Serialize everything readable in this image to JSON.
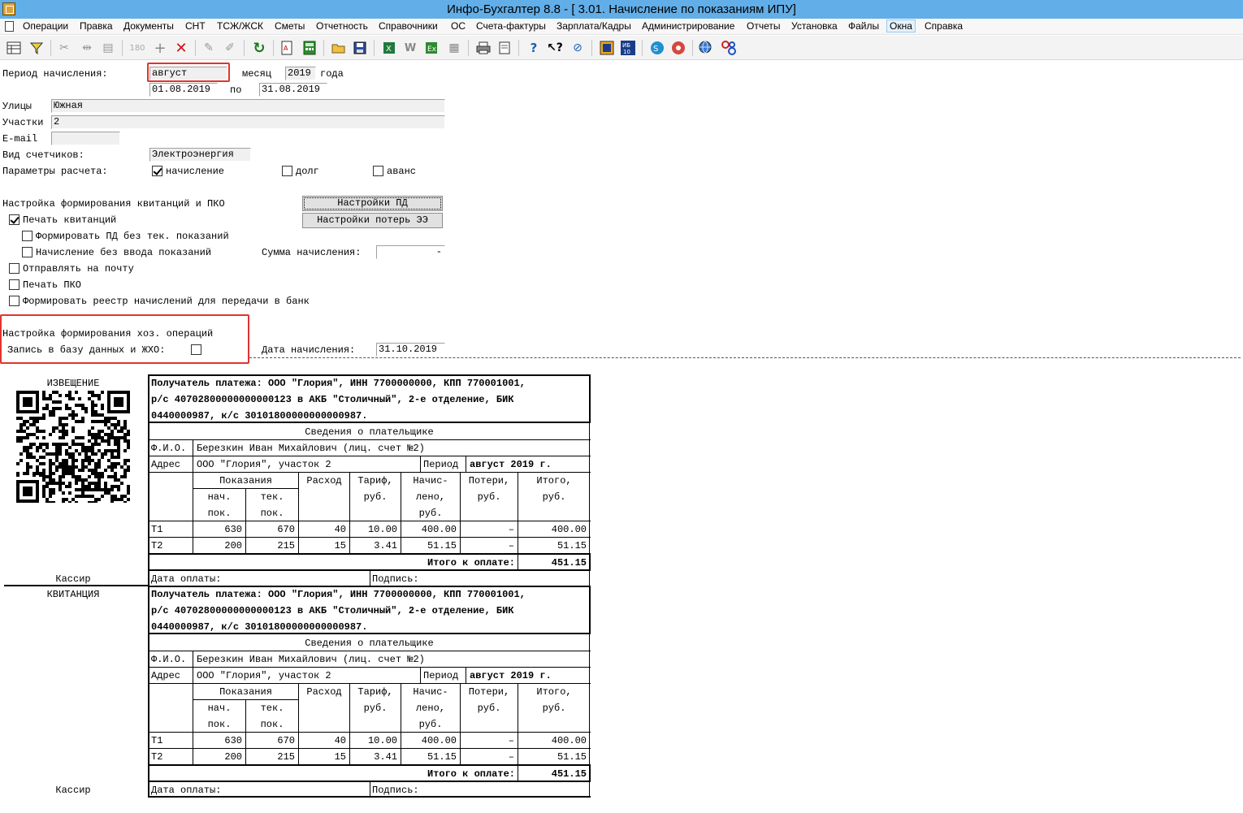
{
  "window": {
    "title": "Инфо-Бухгалтер 8.8 - [ 3.01. Начисление по показаниям ИПУ]"
  },
  "menu": {
    "items": [
      "Операции",
      "Правка",
      "Документы",
      "СНТ",
      "ТСЖ/ЖСК",
      "Сметы",
      "Отчетность",
      "Справочники",
      "ОС",
      "Счета-фактуры",
      "Зарплата/Кадры",
      "Администрирование",
      "Отчеты",
      "Установка",
      "Файлы",
      "Окна",
      "Справка"
    ]
  },
  "form": {
    "period_label": "Период начисления:",
    "month_value": "август",
    "month_label": "месяц",
    "year_value": "2019",
    "year_label": "года",
    "date_from": "01.08.2019",
    "to_label": "по",
    "date_to": "31.08.2019",
    "streets_label": "Улицы",
    "streets_value": "Южная",
    "plots_label": "Участки",
    "plots_value": "2",
    "email_label": "E-mail",
    "email_value": "",
    "meter_type_label": "Вид счетчиков:",
    "meter_type_value": "Электроэнергия",
    "calc_params_label": "Параметры расчета:",
    "param_accrual": "начисление",
    "param_debt": "долг",
    "param_advance": "аванс",
    "receipts_section": "Настройка формирования квитанций и ПКО",
    "btn_pd_settings": "Настройки ПД",
    "btn_loss_settings": "Настройки потерь ЭЭ",
    "print_receipts": "Печать квитанций",
    "form_pd_no_readings": "Формировать ПД без тек. показаний",
    "accrual_no_readings": "Начисление без ввода показаний",
    "accrual_sum_label": "Сумма начисления:",
    "accrual_sum_value": "-",
    "send_mail": "Отправлять на почту",
    "print_pko": "Печать ПКО",
    "bank_registry": "Формировать реестр начислений для передачи в банк",
    "ops_section": "Настройка формирования хоз. операций",
    "write_db": "Запись в базу данных и ЖХО:",
    "accrual_date_label": "Дата начисления:",
    "accrual_date_value": "31.10.2019"
  },
  "receipt": {
    "notice_title": "ИЗВЕЩЕНИЕ",
    "receipt_title": "КВИТАНЦИЯ",
    "cashier": "Кассир",
    "payee_line1": "Получатель платежа: ООО \"Глория\", ИНН 7700000000, КПП 770001001,",
    "payee_line2": "р/с 40702800000000000123 в АКБ \"Столичный\", 2-е отделение, БИК",
    "payee_line3": "0440000987, к/с 30101800000000000987.",
    "payer_info": "Сведения о плательщике",
    "fio_label": "Ф.И.О.",
    "fio_value": "Березкин Иван Михайлович (лиц. счет №2)",
    "address_label": "Адрес",
    "address_value": "ООО \"Глория\", участок 2",
    "period_label": "Период",
    "period_value": "август 2019 г.",
    "col_readings": "Показания",
    "col_start1": "нач.",
    "col_start2": "пок.",
    "col_cur1": "тек.",
    "col_cur2": "пок.",
    "col_usage": "Расход",
    "col_tariff1": "Тариф,",
    "col_tariff2": "руб.",
    "col_accr1": "Начис-",
    "col_accr2": "лено,",
    "col_accr3": "руб.",
    "col_loss1": "Потери,",
    "col_loss2": "руб.",
    "col_total1": "Итого,",
    "col_total2": "руб.",
    "rows": [
      {
        "zone": "Т1",
        "start": "630",
        "cur": "670",
        "usage": "40",
        "tariff": "10.00",
        "accrued": "400.00",
        "loss": "–",
        "total": "400.00"
      },
      {
        "zone": "Т2",
        "start": "200",
        "cur": "215",
        "usage": "15",
        "tariff": "3.41",
        "accrued": "51.15",
        "loss": "–",
        "total": "51.15"
      }
    ],
    "total_label": "Итого к оплате:",
    "total_value": "451.15",
    "pay_date_label": "Дата оплаты:",
    "signature_label": "Подпись:"
  }
}
